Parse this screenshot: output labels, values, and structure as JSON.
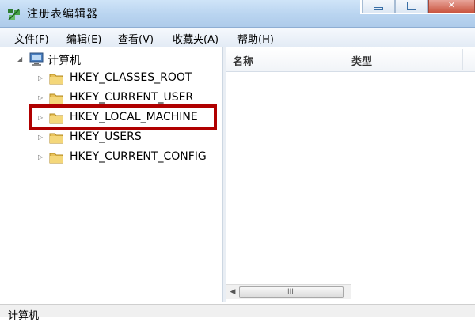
{
  "window": {
    "title": "注册表编辑器",
    "icon": "registry-editor-icon",
    "close_glyph": "✕"
  },
  "menu": {
    "items": [
      {
        "label": "文件(F)"
      },
      {
        "label": "编辑(E)"
      },
      {
        "label": "查看(V)"
      },
      {
        "label": "收藏夹(A)"
      },
      {
        "label": "帮助(H)"
      }
    ]
  },
  "tree": {
    "root": {
      "label": "计算机",
      "icon": "computer-icon",
      "expander": "◢"
    },
    "nodes": [
      {
        "label": "HKEY_CLASSES_ROOT",
        "expander": "▷",
        "icon": "folder-icon"
      },
      {
        "label": "HKEY_CURRENT_USER",
        "expander": "▷",
        "icon": "folder-icon"
      },
      {
        "label": "HKEY_LOCAL_MACHINE",
        "expander": "▷",
        "icon": "folder-icon",
        "highlighted": true
      },
      {
        "label": "HKEY_USERS",
        "expander": "▷",
        "icon": "folder-icon"
      },
      {
        "label": "HKEY_CURRENT_CONFIG",
        "expander": "▷",
        "icon": "folder-icon"
      }
    ]
  },
  "list": {
    "columns": [
      {
        "label": "名称"
      },
      {
        "label": "类型"
      }
    ]
  },
  "scrollbar": {
    "left_arrow": "◀",
    "grip": "III"
  },
  "status": {
    "text": "计算机"
  },
  "colors": {
    "highlight_border": "#b00000",
    "folder": "#e8c25a",
    "title_bar": "#b9d4f0"
  }
}
